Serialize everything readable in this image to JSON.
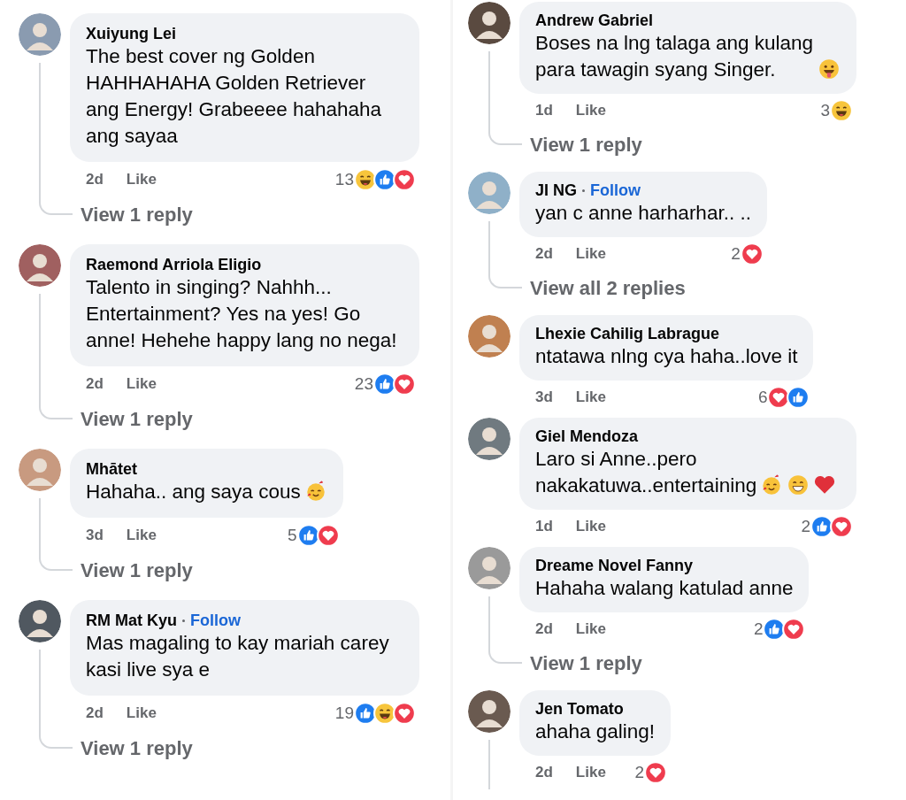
{
  "columns": [
    {
      "comments": [
        {
          "name": "Xuiyung Lei",
          "text": "The best cover ng Golden HAHHAHAHA Golden Retriever ang Energy! Grabeeee hahahaha ang sayaa",
          "time": "2d",
          "like": "Like",
          "count": "13",
          "reactions": [
            {
              "kind": "haha"
            },
            {
              "kind": "like"
            },
            {
              "kind": "love"
            }
          ],
          "thread": true,
          "reply": "View 1 reply"
        },
        {
          "name": "Raemond Arriola Eligio",
          "text": "Talento in singing? Nahhh... Entertainment? Yes na yes! Go anne! Hehehe happy lang no nega!",
          "time": "2d",
          "like": "Like",
          "count": "23",
          "reactions": [
            {
              "kind": "like"
            },
            {
              "kind": "love"
            }
          ],
          "thread": true,
          "reply": "View 1 reply"
        },
        {
          "name": "Mhātet",
          "text": "Hahaha.. ang saya cous",
          "emojis": [
            {
              "kind": "hearts-face"
            }
          ],
          "time": "3d",
          "like": "Like",
          "count": "5",
          "reactions": [
            {
              "kind": "like"
            },
            {
              "kind": "love"
            }
          ],
          "thread": true,
          "reply": "View 1 reply"
        },
        {
          "name": "RM Mat Kyu",
          "follow": "Follow",
          "text": "Mas magaling to kay mariah carey kasi live sya e",
          "time": "2d",
          "like": "Like",
          "count": "19",
          "reactions": [
            {
              "kind": "like"
            },
            {
              "kind": "haha"
            },
            {
              "kind": "love"
            }
          ],
          "thread": true,
          "reply": "View 1 reply"
        }
      ]
    },
    {
      "comments": [
        {
          "name": "Andrew Gabriel",
          "text": "Boses na lng talaga ang kulang para tawagin syang Singer.",
          "emojis": [
            {
              "kind": "tongue-face"
            }
          ],
          "time": "1d",
          "like": "Like",
          "count": "3",
          "reactions": [
            {
              "kind": "haha"
            }
          ],
          "thread": true,
          "reply": "View 1 reply"
        },
        {
          "name": "JI NG",
          "follow": "Follow",
          "text": "yan c anne harharhar.. ..",
          "time": "2d",
          "like": "Like",
          "count": "2",
          "reactions": [
            {
              "kind": "love"
            }
          ],
          "thread": true,
          "reply": "View all 2 replies"
        },
        {
          "name": "Lhexie Cahilig Labrague",
          "text": "ntatawa nlng cya haha..love it",
          "time": "3d",
          "like": "Like",
          "count": "6",
          "reactions": [
            {
              "kind": "love"
            },
            {
              "kind": "like"
            }
          ],
          "thread": false
        },
        {
          "name": "Giel Mendoza",
          "text": "Laro si Anne..pero nakakatuwa..entertaining",
          "emojis": [
            {
              "kind": "hearts-face"
            },
            {
              "kind": "grin-face"
            },
            {
              "kind": "heart"
            }
          ],
          "time": "1d",
          "like": "Like",
          "count": "2",
          "reactions": [
            {
              "kind": "like"
            },
            {
              "kind": "love"
            }
          ],
          "thread": false
        },
        {
          "name": "Dreame Novel Fanny",
          "text": "Hahaha walang katulad anne",
          "time": "2d",
          "like": "Like",
          "count": "2",
          "reactions": [
            {
              "kind": "like"
            },
            {
              "kind": "love"
            }
          ],
          "thread": true,
          "reply": "View 1 reply"
        },
        {
          "name": "Jen Tomato",
          "text": "ahaha galing!",
          "time": "2d",
          "like": "Like",
          "count": "2",
          "reactions": [
            {
              "kind": "love"
            }
          ],
          "thread": true
        }
      ]
    }
  ]
}
